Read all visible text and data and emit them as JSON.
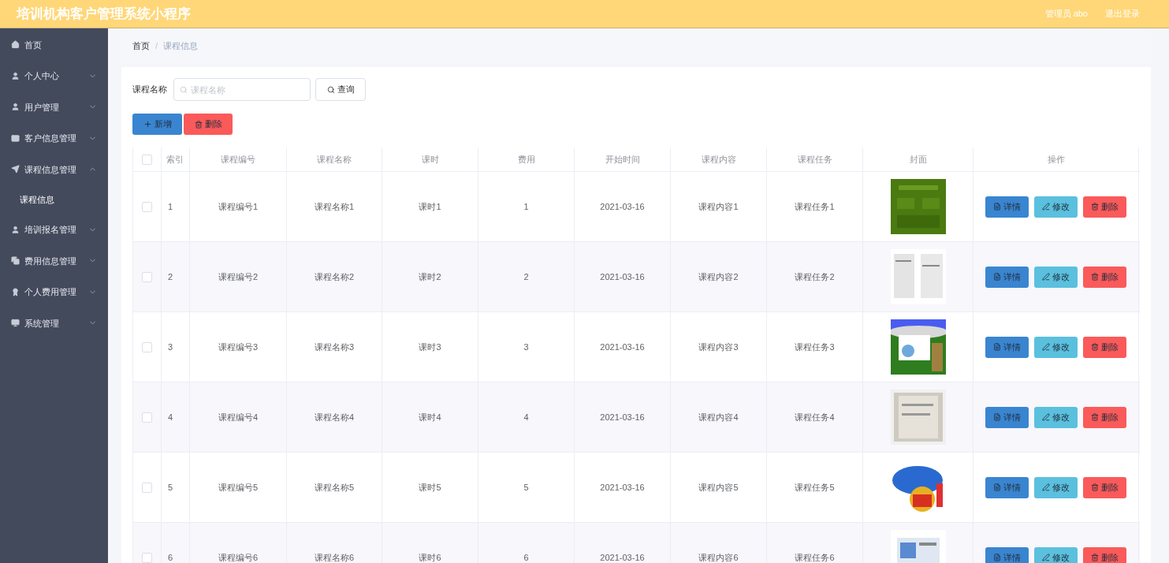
{
  "header": {
    "title": "培训机构客户管理系统小程序",
    "user": "管理员 abo",
    "logout": "退出登录"
  },
  "sidebar": {
    "items": [
      {
        "kind": "link",
        "label": "首页"
      },
      {
        "kind": "menu",
        "label": "个人中心",
        "expanded": false
      },
      {
        "kind": "menu",
        "label": "用户管理",
        "expanded": false
      },
      {
        "kind": "menu",
        "label": "客户信息管理",
        "expanded": false
      },
      {
        "kind": "menu",
        "label": "课程信息管理",
        "expanded": true,
        "children": [
          {
            "label": "课程信息"
          }
        ]
      },
      {
        "kind": "menu",
        "label": "培训报名管理",
        "expanded": false
      },
      {
        "kind": "menu",
        "label": "费用信息管理",
        "expanded": false
      },
      {
        "kind": "menu",
        "label": "个人费用管理",
        "expanded": false
      },
      {
        "kind": "menu",
        "label": "系统管理",
        "expanded": false
      }
    ]
  },
  "breadcrumb": {
    "items": [
      "首页",
      "课程信息"
    ],
    "separator": "/"
  },
  "search": {
    "label": "课程名称",
    "placeholder": "课程名称",
    "button": "查询"
  },
  "actions": {
    "add": "新增",
    "delete": "删除"
  },
  "table": {
    "select_all_checked": false,
    "columns": [
      "索引",
      "课程编号",
      "课程名称",
      "课时",
      "费用",
      "开始时间",
      "课程内容",
      "课程任务",
      "封面",
      "操作"
    ],
    "rows": [
      {
        "index": "1",
        "code": "课程编号1",
        "name": "课程名称1",
        "hours": "课时1",
        "fee": "1",
        "start": "2021-03-16",
        "content": "课程内容1",
        "task": "课程任务1",
        "checked": false,
        "buttons": [
          "详情",
          "修改",
          "删除"
        ]
      },
      {
        "index": "2",
        "code": "课程编号2",
        "name": "课程名称2",
        "hours": "课时2",
        "fee": "2",
        "start": "2021-03-16",
        "content": "课程内容2",
        "task": "课程任务2",
        "checked": false,
        "buttons": [
          "详情",
          "修改",
          "删除"
        ]
      },
      {
        "index": "3",
        "code": "课程编号3",
        "name": "课程名称3",
        "hours": "课时3",
        "fee": "3",
        "start": "2021-03-16",
        "content": "课程内容3",
        "task": "课程任务3",
        "checked": false,
        "buttons": [
          "详情",
          "修改",
          "删除"
        ]
      },
      {
        "index": "4",
        "code": "课程编号4",
        "name": "课程名称4",
        "hours": "课时4",
        "fee": "4",
        "start": "2021-03-16",
        "content": "课程内容4",
        "task": "课程任务4",
        "checked": false,
        "buttons": [
          "详情",
          "修改",
          "删除"
        ]
      },
      {
        "index": "5",
        "code": "课程编号5",
        "name": "课程名称5",
        "hours": "课时5",
        "fee": "5",
        "start": "2021-03-16",
        "content": "课程内容5",
        "task": "课程任务5",
        "checked": false,
        "buttons": [
          "详情",
          "修改",
          "删除"
        ]
      },
      {
        "index": "6",
        "code": "课程编号6",
        "name": "课程名称6",
        "hours": "课时6",
        "fee": "6",
        "start": "2021-03-16",
        "content": "课程内容6",
        "task": "课程任务6",
        "checked": false,
        "buttons": [
          "详情",
          "修改",
          "删除"
        ]
      }
    ]
  }
}
